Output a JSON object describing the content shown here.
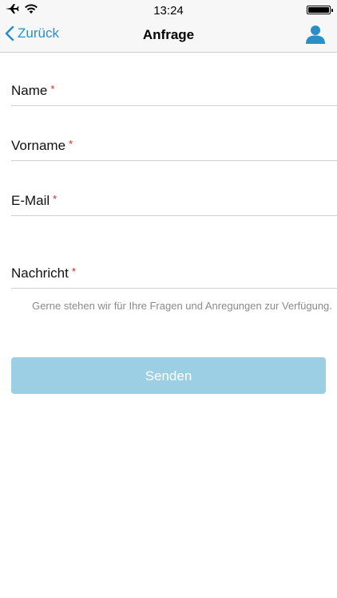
{
  "status_bar": {
    "time": "13:24",
    "icons": [
      "airplane-icon",
      "wifi-icon",
      "battery-icon"
    ]
  },
  "nav": {
    "back_label": "Zurück",
    "title": "Anfrage",
    "accent_color": "#2a8ec7",
    "user_icon": "user-icon"
  },
  "form": {
    "fields": [
      {
        "label": "Name",
        "required_mark": "*",
        "value": ""
      },
      {
        "label": "Vorname",
        "required_mark": "*",
        "value": ""
      },
      {
        "label": "E-Mail",
        "required_mark": "*",
        "value": ""
      },
      {
        "label": "Nachricht",
        "required_mark": "*",
        "value": ""
      }
    ],
    "info_text": "Gerne stehen wir für Ihre Fragen und Anregungen zur Verfügung.",
    "submit_label": "Senden",
    "submit_color": "#9ccfe3"
  }
}
